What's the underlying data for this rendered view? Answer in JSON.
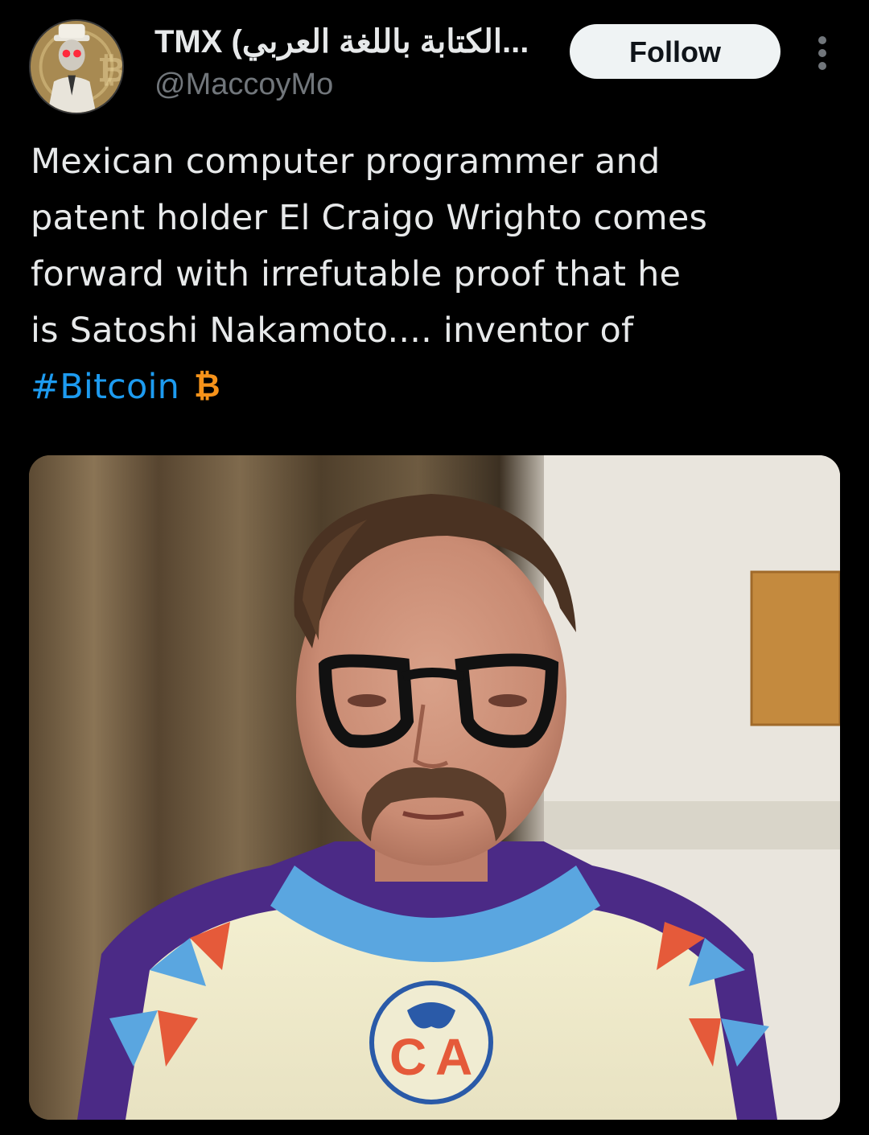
{
  "author": {
    "display_name": "TMX (الكتابة باللغة العربي...",
    "handle": "@MaccoyMo",
    "avatar_icon": "avatar-image"
  },
  "actions": {
    "follow_label": "Follow",
    "more_icon": "more-options-icon"
  },
  "tweet": {
    "text_lines": [
      "Mexican computer programmer and",
      "patent holder El Craigo Wrighto comes",
      "forward with irrefutable proof that he",
      "is Satoshi Nakamoto.... inventor of"
    ],
    "hashtag": "#Bitcoin",
    "emoji_icon": "bitcoin-icon"
  },
  "colors": {
    "background": "#000000",
    "text": "#e7e9ea",
    "secondary_text": "#71767b",
    "link": "#1d9bf0",
    "follow_bg": "#eff3f4",
    "bitcoin_orange": "#f7931a"
  }
}
